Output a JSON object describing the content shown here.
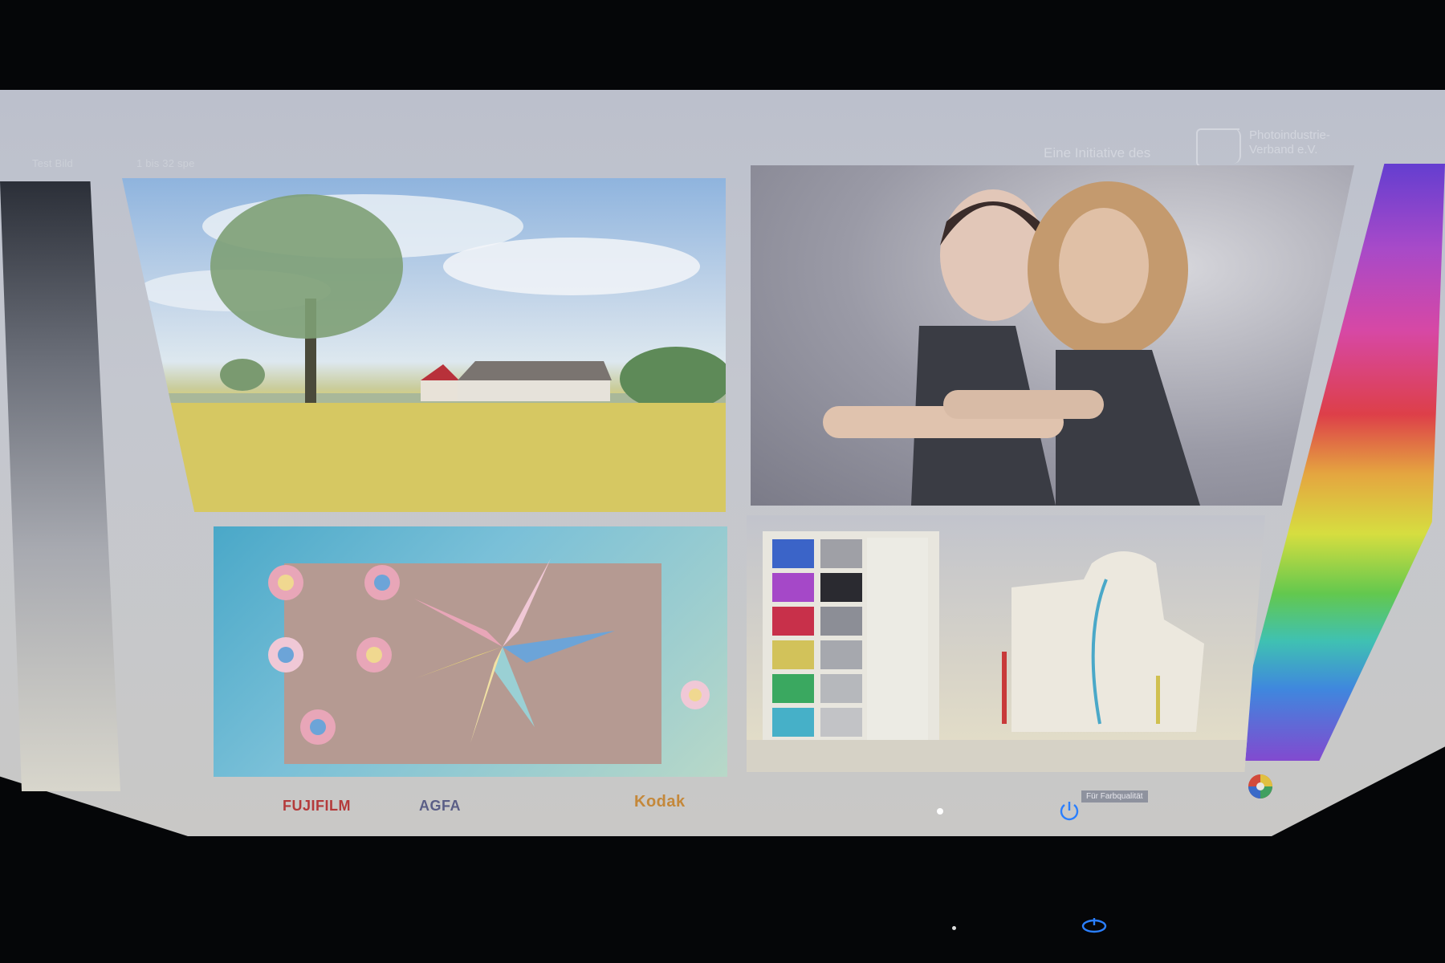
{
  "header": {
    "initiative_text": "Eine Initiative des",
    "logo_line1": "Photoindustrie-",
    "logo_line2": "Verband e.V.",
    "left_text_1": "Test Bild",
    "left_text_2": "1 bis 32 spe"
  },
  "panels": {
    "landscape": "landscape-photo",
    "portrait": "portrait-photo",
    "pinwheel": "pinwheel-photo",
    "color_chart": "color-chart-photo"
  },
  "brands": {
    "fujifilm": "FUJIFILM",
    "agfa": "AGFA",
    "kodak": "Kodak",
    "center_label": "Für Farbqualität"
  },
  "colors": {
    "chart_swatches": [
      "#3b64c8",
      "#a548c8",
      "#c8304a",
      "#d2c25a",
      "#3aa860",
      "#46b0c8"
    ],
    "chart_grays": [
      "#9fa0a6",
      "#2a2a30",
      "#8c8e96",
      "#a6a8ae",
      "#b6b8bc",
      "#c2c3c6"
    ],
    "power_led": "#2a7fff"
  },
  "icons": {
    "power": "power-icon",
    "color_wheel": "color-wheel-icon"
  }
}
